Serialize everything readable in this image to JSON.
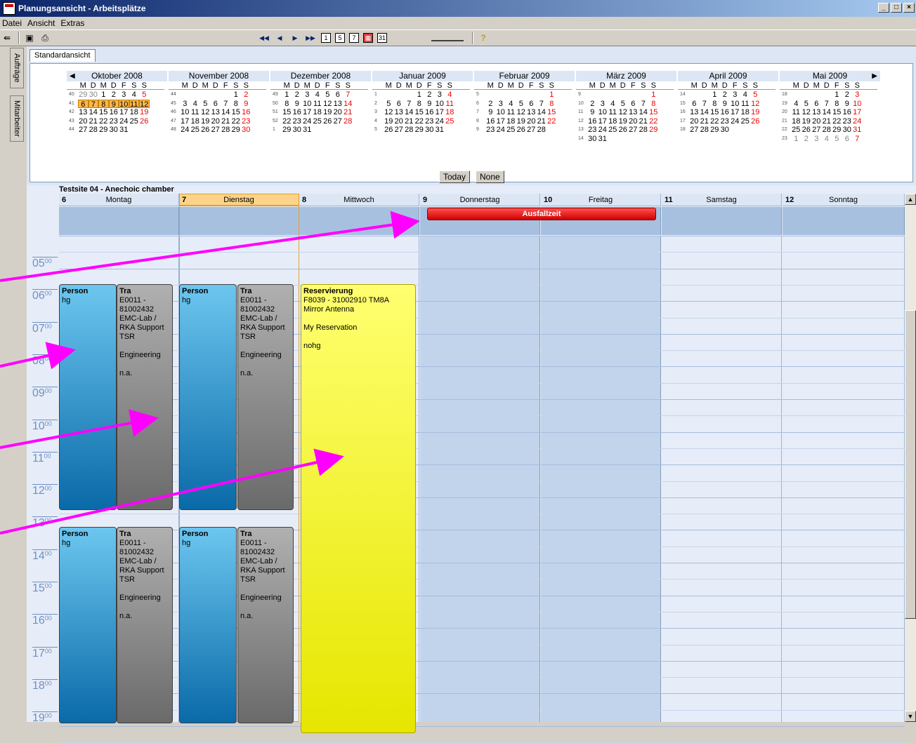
{
  "window": {
    "title": "Planungsansicht - Arbeitsplätze",
    "buttons": [
      "_",
      "□",
      "×"
    ]
  },
  "menu": [
    "Datei",
    "Ansicht",
    "Extras"
  ],
  "toolbar": {
    "nav": [
      "◀◀",
      "◀",
      "▶",
      "▶▶"
    ],
    "views": [
      "1",
      "5",
      "7",
      "▦",
      "31"
    ]
  },
  "side_tabs": [
    "Aufträge",
    "Mitarbeiter"
  ],
  "view_tab": "Standardansicht",
  "calendar": {
    "dow": [
      "M",
      "D",
      "M",
      "D",
      "F",
      "S",
      "S"
    ],
    "today_btn": "Today",
    "none_btn": "None",
    "months": [
      {
        "title": "Oktober 2008",
        "weeks": [
          [
            "40",
            "29",
            "30",
            "1",
            "2",
            "3",
            "4",
            "5"
          ],
          [
            "41",
            "6",
            "7",
            "8",
            "9",
            "10",
            "11",
            "12"
          ],
          [
            "42",
            "13",
            "14",
            "15",
            "16",
            "17",
            "18",
            "19"
          ],
          [
            "43",
            "20",
            "21",
            "22",
            "23",
            "24",
            "25",
            "26"
          ],
          [
            "44",
            "27",
            "28",
            "29",
            "30",
            "31",
            "",
            ""
          ]
        ]
      },
      {
        "title": "November 2008",
        "weeks": [
          [
            "44",
            "",
            "",
            "",
            "",
            "",
            "1",
            "2"
          ],
          [
            "45",
            "3",
            "4",
            "5",
            "6",
            "7",
            "8",
            "9"
          ],
          [
            "46",
            "10",
            "11",
            "12",
            "13",
            "14",
            "15",
            "16"
          ],
          [
            "47",
            "17",
            "18",
            "19",
            "20",
            "21",
            "22",
            "23"
          ],
          [
            "48",
            "24",
            "25",
            "26",
            "27",
            "28",
            "29",
            "30"
          ]
        ]
      },
      {
        "title": "Dezember 2008",
        "weeks": [
          [
            "49",
            "1",
            "2",
            "3",
            "4",
            "5",
            "6",
            "7"
          ],
          [
            "50",
            "8",
            "9",
            "10",
            "11",
            "12",
            "13",
            "14"
          ],
          [
            "51",
            "15",
            "16",
            "17",
            "18",
            "19",
            "20",
            "21"
          ],
          [
            "52",
            "22",
            "23",
            "24",
            "25",
            "26",
            "27",
            "28"
          ],
          [
            "1",
            "29",
            "30",
            "31",
            "",
            "",
            "",
            ""
          ]
        ]
      },
      {
        "title": "Januar 2009",
        "weeks": [
          [
            "1",
            "",
            "",
            "",
            "1",
            "2",
            "3",
            "4"
          ],
          [
            "2",
            "5",
            "6",
            "7",
            "8",
            "9",
            "10",
            "11"
          ],
          [
            "3",
            "12",
            "13",
            "14",
            "15",
            "16",
            "17",
            "18"
          ],
          [
            "4",
            "19",
            "20",
            "21",
            "22",
            "23",
            "24",
            "25"
          ],
          [
            "5",
            "26",
            "27",
            "28",
            "29",
            "30",
            "31",
            ""
          ]
        ]
      },
      {
        "title": "Februar 2009",
        "weeks": [
          [
            "5",
            "",
            "",
            "",
            "",
            "",
            "",
            "1"
          ],
          [
            "6",
            "2",
            "3",
            "4",
            "5",
            "6",
            "7",
            "8"
          ],
          [
            "7",
            "9",
            "10",
            "11",
            "12",
            "13",
            "14",
            "15"
          ],
          [
            "8",
            "16",
            "17",
            "18",
            "19",
            "20",
            "21",
            "22"
          ],
          [
            "9",
            "23",
            "24",
            "25",
            "26",
            "27",
            "28",
            ""
          ]
        ]
      },
      {
        "title": "März 2009",
        "weeks": [
          [
            "9",
            "",
            "",
            "",
            "",
            "",
            "",
            "1"
          ],
          [
            "10",
            "2",
            "3",
            "4",
            "5",
            "6",
            "7",
            "8"
          ],
          [
            "11",
            "9",
            "10",
            "11",
            "12",
            "13",
            "14",
            "15"
          ],
          [
            "12",
            "16",
            "17",
            "18",
            "19",
            "20",
            "21",
            "22"
          ],
          [
            "13",
            "23",
            "24",
            "25",
            "26",
            "27",
            "28",
            "29"
          ],
          [
            "14",
            "30",
            "31",
            "",
            "",
            "",
            "",
            ""
          ]
        ]
      },
      {
        "title": "April 2009",
        "weeks": [
          [
            "14",
            "",
            "",
            "1",
            "2",
            "3",
            "4",
            "5"
          ],
          [
            "15",
            "6",
            "7",
            "8",
            "9",
            "10",
            "11",
            "12"
          ],
          [
            "16",
            "13",
            "14",
            "15",
            "16",
            "17",
            "18",
            "19"
          ],
          [
            "17",
            "20",
            "21",
            "22",
            "23",
            "24",
            "25",
            "26"
          ],
          [
            "18",
            "27",
            "28",
            "29",
            "30",
            "",
            "",
            ""
          ]
        ]
      },
      {
        "title": "Mai 2009",
        "weeks": [
          [
            "18",
            "",
            "",
            "",
            "",
            "1",
            "2",
            "3"
          ],
          [
            "19",
            "4",
            "5",
            "6",
            "7",
            "8",
            "9",
            "10"
          ],
          [
            "20",
            "11",
            "12",
            "13",
            "14",
            "15",
            "16",
            "17"
          ],
          [
            "21",
            "18",
            "19",
            "20",
            "21",
            "22",
            "23",
            "24"
          ],
          [
            "22",
            "25",
            "26",
            "27",
            "28",
            "29",
            "30",
            "31"
          ],
          [
            "23",
            "1",
            "2",
            "3",
            "4",
            "5",
            "6",
            "7"
          ]
        ]
      }
    ]
  },
  "schedule": {
    "location": "Testsite 04 - Anechoic chamber",
    "days": [
      {
        "num": "6",
        "name": "Montag"
      },
      {
        "num": "7",
        "name": "Dienstag"
      },
      {
        "num": "8",
        "name": "Mittwoch"
      },
      {
        "num": "9",
        "name": "Donnerstag"
      },
      {
        "num": "10",
        "name": "Freitag"
      },
      {
        "num": "11",
        "name": "Samstag"
      },
      {
        "num": "12",
        "name": "Sonntag"
      }
    ],
    "allday_event": "Ausfallzeit",
    "hours": [
      "05",
      "06",
      "07",
      "08",
      "09",
      "10",
      "11",
      "12",
      "13",
      "14",
      "15",
      "16",
      "17",
      "18",
      "19"
    ],
    "minutes": "00",
    "person": {
      "title": "Person",
      "text": "hg"
    },
    "tra": {
      "title": "Tra",
      "lines": [
        "E0011 -",
        "81002432",
        "EMC-Lab /",
        "RKA Support",
        "TSR",
        "",
        "Engineering",
        "",
        "n.a."
      ]
    },
    "reservation": {
      "title": "Reservierung",
      "lines": [
        "F8039 - 31002910  TM8A",
        "Mirror Antenna",
        "",
        "My Reservation",
        "",
        "nohg"
      ]
    }
  },
  "colors": {
    "accent": "#ff00ff",
    "today": "#fbb84c",
    "person": "#1a8ac8",
    "tra": "#8a8a8a",
    "reservation": "#f5f530",
    "ausfall": "#e00000"
  }
}
